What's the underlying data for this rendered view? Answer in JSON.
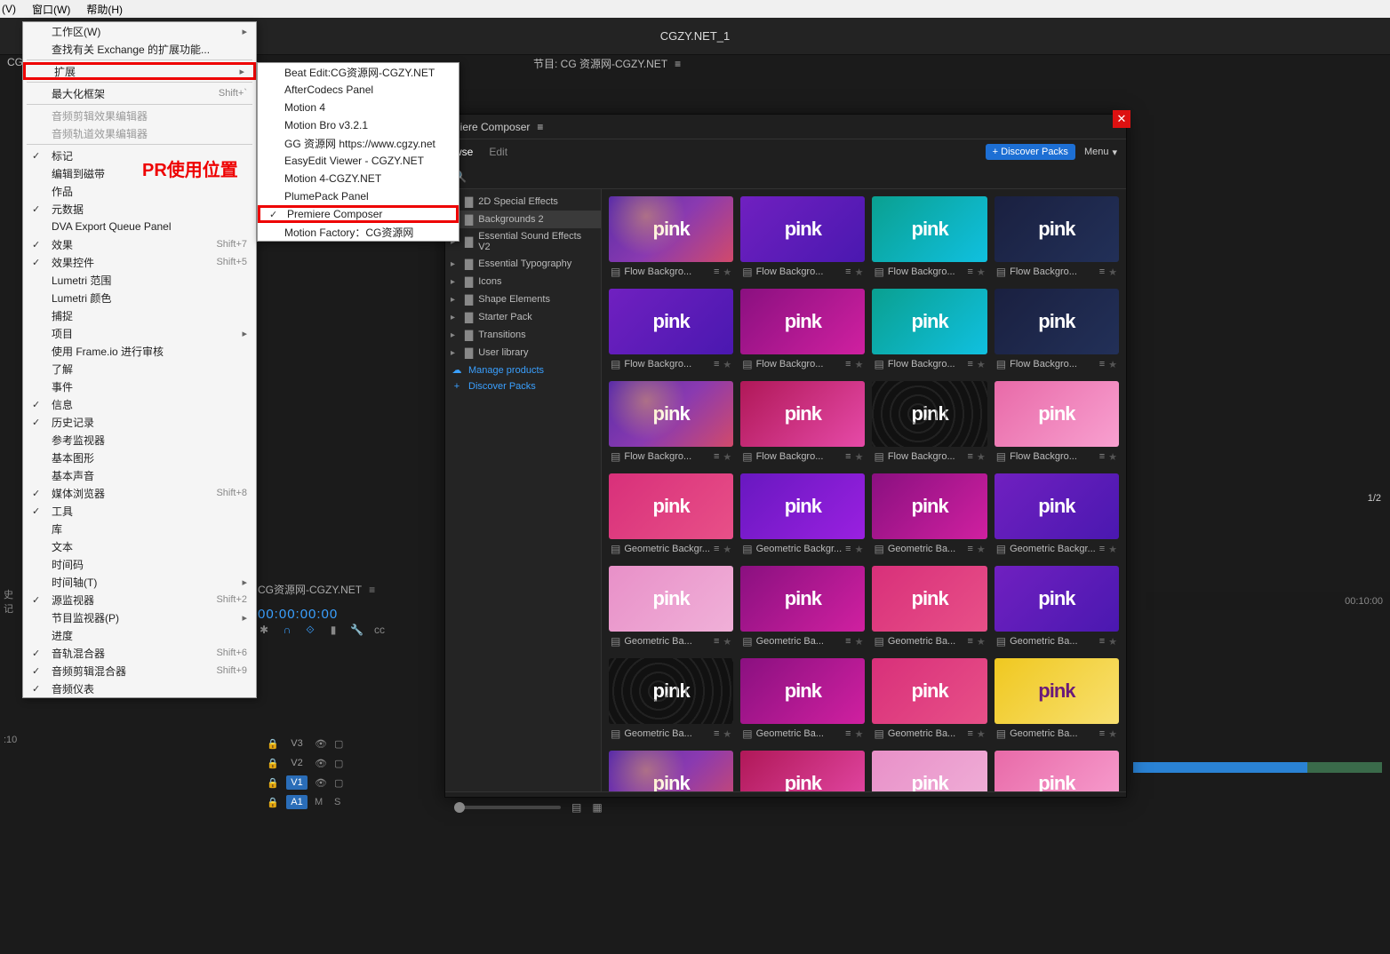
{
  "topbar": {
    "view": "(V)",
    "window": "窗口(W)",
    "help": "帮助(H)"
  },
  "workspace_tab": "CGZY.NET_1",
  "project_label": "CGZY",
  "window_menu": {
    "workspace": "工作区(W)",
    "exchange": "查找有关 Exchange 的扩展功能...",
    "extensions": "扩展",
    "maximize": "最大化框架",
    "maximize_sc": "Shift+`",
    "audio_clip_fx": "音频剪辑效果编辑器",
    "audio_track_fx": "音频轨道效果编辑器",
    "markers": "标记",
    "edit_to_tape": "编辑到磁带",
    "works": "作品",
    "metadata": "元数据",
    "dva_export": "DVA Export Queue Panel",
    "effects": "效果",
    "effects_sc": "Shift+7",
    "effect_controls": "效果控件",
    "effect_controls_sc": "Shift+5",
    "lumetri_scope": "Lumetri 范围",
    "lumetri_color": "Lumetri 颜色",
    "capture": "捕捉",
    "project": "项目",
    "frameio": "使用 Frame.io 进行审核",
    "learn": "了解",
    "events": "事件",
    "info": "信息",
    "history": "历史记录",
    "ref_monitor": "参考监视器",
    "essential_graphics": "基本图形",
    "essential_sound": "基本声音",
    "media_browser": "媒体浏览器",
    "media_browser_sc": "Shift+8",
    "tools": "工具",
    "libraries": "库",
    "text": "文本",
    "timecode": "时间码",
    "timeline": "时间轴(T)",
    "source_monitor": "源监视器",
    "source_monitor_sc": "Shift+2",
    "program_monitor": "节目监视器(P)",
    "progress": "进度",
    "audio_track_mixer": "音轨混合器",
    "audio_track_mixer_sc": "Shift+6",
    "audio_clip_mixer": "音频剪辑混合器",
    "audio_clip_mixer_sc": "Shift+9",
    "audio_meters": "音频仪表"
  },
  "ext_menu": {
    "beat_edit": "Beat Edit:CG资源网-CGZY.NET",
    "aftercodecs": "AfterCodecs Panel",
    "motion4": "Motion 4",
    "motion_bro": "Motion Bro v3.2.1",
    "gg": "GG 资源网 https://www.cgzy.net",
    "easyedit": "EasyEdit Viewer - CGZY.NET",
    "motion4_cgzy": "Motion 4-CGZY.NET",
    "plumepack": "PlumePack Panel",
    "premiere_composer": "Premiere Composer",
    "motion_factory": "Motion Factory：CG资源网"
  },
  "red_label": "PR使用位置",
  "seq": {
    "name": "CG资源网-CGZY.NET",
    "tc": "00:00:00:00"
  },
  "history_left": "史记",
  "ten": ":10",
  "program": {
    "label": "节目: CG 资源网-CGZY.NET"
  },
  "tracks": {
    "v3": "V3",
    "v2": "V2",
    "v1": "V1",
    "a1": "A1"
  },
  "composer": {
    "title": "niere Composer",
    "browse": "wse",
    "edit": "Edit",
    "discover": "+ Discover Packs",
    "menu": "Menu",
    "sidebar": [
      {
        "label": "2D Special Effects"
      },
      {
        "label": "Backgrounds 2",
        "selected": true
      },
      {
        "label": "Essential Sound Effects V2"
      },
      {
        "label": "Essential Typography"
      },
      {
        "label": "Icons"
      },
      {
        "label": "Shape Elements"
      },
      {
        "label": "Starter Pack"
      },
      {
        "label": "Transitions"
      },
      {
        "label": "User library"
      }
    ],
    "manage": "Manage products",
    "discover_link": "Discover Packs",
    "thumb_text": "pink",
    "cards": [
      {
        "name": "Flow Backgro...",
        "cls": "g1"
      },
      {
        "name": "Flow Backgro...",
        "cls": "g2"
      },
      {
        "name": "Flow Backgro...",
        "cls": "g3"
      },
      {
        "name": "Flow Backgro...",
        "cls": "g4"
      },
      {
        "name": "Flow Backgro...",
        "cls": "g2"
      },
      {
        "name": "Flow Backgro...",
        "cls": "g6"
      },
      {
        "name": "Flow Backgro...",
        "cls": "g3"
      },
      {
        "name": "Flow Backgro...",
        "cls": "g4"
      },
      {
        "name": "Flow Backgro...",
        "cls": "g1"
      },
      {
        "name": "Flow Backgro...",
        "cls": "g5"
      },
      {
        "name": "Flow Backgro...",
        "cls": "g7"
      },
      {
        "name": "Flow Backgro...",
        "cls": "g8"
      },
      {
        "name": "Geometric Backgr...",
        "cls": "g9"
      },
      {
        "name": "Geometric Backgr...",
        "cls": "g10"
      },
      {
        "name": "Geometric Ba...",
        "cls": "g6"
      },
      {
        "name": "Geometric Backgr...",
        "cls": "g2"
      },
      {
        "name": "Geometric Ba...",
        "cls": "g12"
      },
      {
        "name": "Geometric Ba...",
        "cls": "g6"
      },
      {
        "name": "Geometric Ba...",
        "cls": "g9"
      },
      {
        "name": "Geometric Ba...",
        "cls": "g2"
      },
      {
        "name": "Geometric Ba...",
        "cls": "g7"
      },
      {
        "name": "Geometric Ba...",
        "cls": "g6"
      },
      {
        "name": "Geometric Ba...",
        "cls": "g9"
      },
      {
        "name": "Geometric Ba...",
        "cls": "g11"
      },
      {
        "name": "",
        "cls": "g1"
      },
      {
        "name": "",
        "cls": "g5"
      },
      {
        "name": "",
        "cls": "g12"
      },
      {
        "name": "",
        "cls": "g8"
      }
    ]
  },
  "right": {
    "frac": "1/2",
    "ruler_end": "00:10:00"
  }
}
